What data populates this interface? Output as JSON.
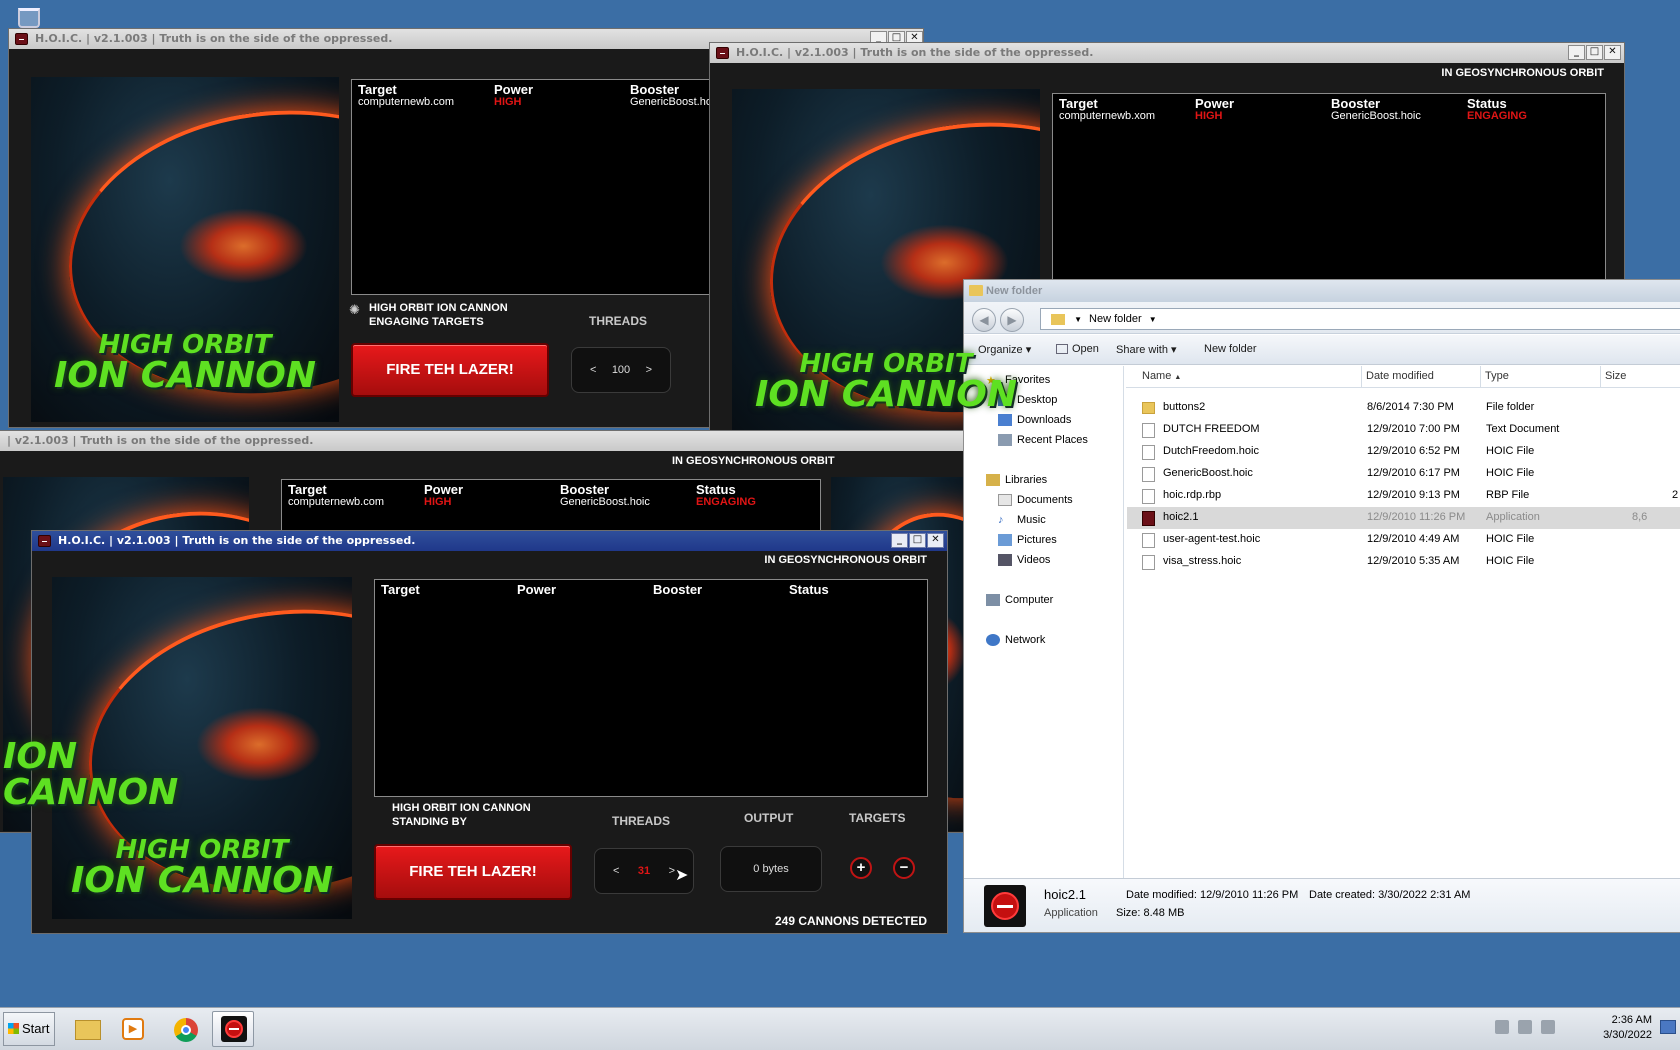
{
  "hoic": {
    "window_title": "H.O.I.C. | v2.1.003 | Truth is on the side of the oppressed.",
    "partial_title": "| v2.1.003 | Truth is on the side of the oppressed.",
    "logo_line1": "HIGH ORBIT",
    "logo_line2": "ION CANNON",
    "orbit_status": "IN GEOSYNCHRONOUS ORBIT",
    "columns": {
      "target": "Target",
      "power": "Power",
      "booster": "Booster",
      "status": "Status"
    },
    "row_a": {
      "target": "computernewb.com",
      "power": "HIGH",
      "booster": "GenericBoost.hoic",
      "status": "ENGAGING"
    },
    "row_b": {
      "target": "computernewb.xom",
      "power": "HIGH",
      "booster": "GenericBoost.hoic",
      "status": "ENGAGING"
    },
    "engaging_line1": "HIGH ORBIT ION CANNON",
    "engaging_line2": "ENGAGING TARGETS",
    "standing_line1": "HIGH ORBIT ION CANNON",
    "standing_line2": "STANDING BY",
    "fire_label": "FIRE TEH LAZER!",
    "threads_label": "THREADS",
    "output_label": "OUTPUT",
    "targets_label": "TARGETS",
    "threads_value_bg": "100",
    "threads_value_front": "31",
    "output_value": "0 bytes",
    "cannons_detected": "249 CANNONS DETECTED",
    "arrow_left": "<",
    "arrow_right": ">",
    "plus": "+",
    "minus": "−"
  },
  "window_buttons": {
    "minimize": "_",
    "maximize": "□",
    "close": "✕"
  },
  "explorer": {
    "title": "New folder",
    "address": "New folder",
    "back": "◀",
    "forward": "▶",
    "toolbar": {
      "organize": "Organize",
      "open": "Open",
      "share": "Share with",
      "new_folder": "New folder"
    },
    "nav": {
      "favorites": "Favorites",
      "desktop": "Desktop",
      "downloads": "Downloads",
      "recent": "Recent Places",
      "libraries": "Libraries",
      "documents": "Documents",
      "music": "Music",
      "pictures": "Pictures",
      "videos": "Videos",
      "computer": "Computer",
      "network": "Network"
    },
    "headers": {
      "name": "Name",
      "date": "Date modified",
      "type": "Type",
      "size": "Size"
    },
    "files": [
      {
        "name": "buttons2",
        "date": "8/6/2014 7:30 PM",
        "type": "File folder",
        "size": ""
      },
      {
        "name": "DUTCH FREEDOM",
        "date": "12/9/2010 7:00 PM",
        "type": "Text Document",
        "size": ""
      },
      {
        "name": "DutchFreedom.hoic",
        "date": "12/9/2010 6:52 PM",
        "type": "HOIC File",
        "size": ""
      },
      {
        "name": "GenericBoost.hoic",
        "date": "12/9/2010 6:17 PM",
        "type": "HOIC File",
        "size": ""
      },
      {
        "name": "hoic.rdp.rbp",
        "date": "12/9/2010 9:13 PM",
        "type": "RBP File",
        "size": "2"
      },
      {
        "name": "hoic2.1",
        "date": "12/9/2010 11:26 PM",
        "type": "Application",
        "size": "8,6"
      },
      {
        "name": "user-agent-test.hoic",
        "date": "12/9/2010 4:49 AM",
        "type": "HOIC File",
        "size": ""
      },
      {
        "name": "visa_stress.hoic",
        "date": "12/9/2010 5:35 AM",
        "type": "HOIC File",
        "size": ""
      }
    ],
    "details": {
      "name": "hoic2.1",
      "kind": "Application",
      "modified": "Date modified: 12/9/2010 11:26 PM",
      "created": "Date created: 3/30/2022 2:31 AM",
      "size": "Size: 8.48 MB"
    }
  },
  "taskbar": {
    "start": "Start",
    "time": "2:36 AM",
    "date": "3/30/2022"
  }
}
